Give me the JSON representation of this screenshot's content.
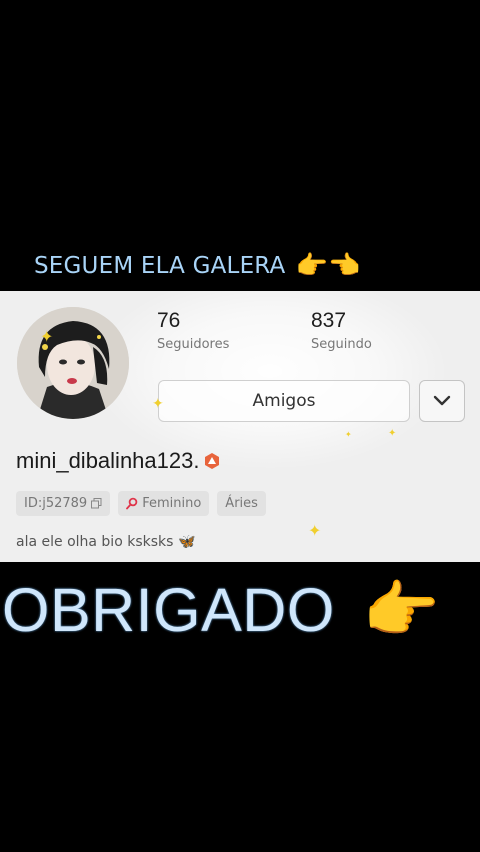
{
  "top_caption": {
    "text": "SEGUEM ELA GALERA",
    "emoji": "👉👈"
  },
  "profile": {
    "followers": {
      "count": "76",
      "label": "Seguidores"
    },
    "following": {
      "count": "837",
      "label": "Seguindo"
    },
    "friends_button": "Amigos",
    "username": "mini_dibalinha123.",
    "id_tag": "ID:j52789",
    "gender_tag": "Feminino",
    "sign_tag": "Áries",
    "bio": "ala ele olha bio ksksks",
    "bio_emoji": "🦋"
  },
  "bottom_caption": {
    "text": "OBRIGADO",
    "emoji": "👉"
  }
}
